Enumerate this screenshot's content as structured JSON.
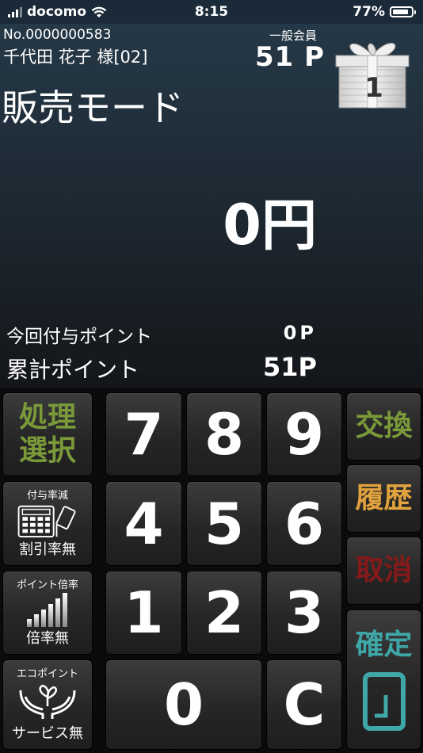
{
  "status_bar": {
    "carrier": "docomo",
    "time": "8:15",
    "battery": "77%"
  },
  "member": {
    "number": "No.0000000583",
    "name": "千代田 花子 様[02]",
    "rank": "一般会員",
    "points": "51 P"
  },
  "gift_badge": "1",
  "mode_title": "販売モード",
  "amount": "0円",
  "this_time_points": {
    "label": "今回付与ポイント",
    "value": "0P"
  },
  "total_points": {
    "label": "累計ポイント",
    "value": "51P"
  },
  "keys": {
    "process_select": [
      "処理",
      "選択"
    ],
    "discount": {
      "title": "付与率減",
      "value": "割引率無"
    },
    "multiplier": {
      "title": "ポイント倍率",
      "value": "倍率無"
    },
    "eco": {
      "title": "エコポイント",
      "value": "サービス無"
    },
    "digits": [
      "7",
      "8",
      "9",
      "4",
      "5",
      "6",
      "1",
      "2",
      "3",
      "0"
    ],
    "clear": "C",
    "exchange": "交換",
    "history": "履歴",
    "cancel": "取消",
    "confirm": "確定"
  },
  "colors": {
    "green": "#7a9a3a",
    "orange": "#e2a23d",
    "red": "#861a1a",
    "teal": "#3fa7a7"
  }
}
